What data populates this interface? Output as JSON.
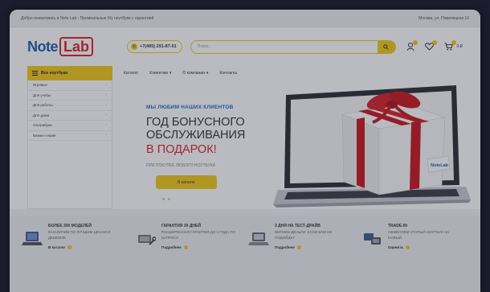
{
  "topbar": {
    "left": "Добро пожаловать в Note Lab - Премиальные б/у ноутбуки с гарантией",
    "right": "Москва, ул. Павелецкая 16"
  },
  "header": {
    "logo_note": "Note",
    "logo_lab": "Lab",
    "phone": "+7(495) 291-87-51",
    "search_placeholder": "Поиск...",
    "cart_count": "0 ₽"
  },
  "nav": {
    "catalog_label": "Все ноутбуки",
    "menu": [
      {
        "label": "Каталог"
      },
      {
        "label": "Клиентам"
      },
      {
        "label": "О компании"
      },
      {
        "label": "Контакты"
      }
    ]
  },
  "sidebar": {
    "items": [
      {
        "label": "Игровые"
      },
      {
        "label": "Для учебы"
      },
      {
        "label": "Для работы"
      },
      {
        "label": "Для дома"
      },
      {
        "label": "Ультрабуки"
      },
      {
        "label": "Бизнес-серия"
      }
    ]
  },
  "hero": {
    "subtitle": "МЫ ЛЮБИМ НАШИХ КЛИЕНТОВ",
    "title_line1": "ГОД БОНУСНОГО",
    "title_line2": "ОБСЛУЖИВАНИЯ",
    "accent": "В ПОДАРОК!",
    "note": "ПРИ ПОКУПКЕ ЛЮБОГО НОУТБУКА",
    "button": "В каталог",
    "gift_tag": "NoteLab"
  },
  "features": [
    {
      "title": "БОЛЕЕ 300 МОДЕЛЕЙ",
      "desc": "В НАЛИЧИИ ПО ЛУЧШИМ ЦЕНАМ И ДЕШЕВЛЕ",
      "link": "В каталог"
    },
    {
      "title": "ГАРАНТИЯ 30 ДНЕЙ",
      "desc": "РАСШИРЕННАЯ ГАРАНТИЯ ДО 1 ГОДА ПО ЗАПРОСУ",
      "link": "Подробнее"
    },
    {
      "title": "3 ДНЯ НА ТЕСТ-ДРАЙВ",
      "desc": "ВЕРНЕМ ДЕНЬГИ, ЕСЛИ ВАМ НЕ ПОДОЙДЕТ",
      "link": "Подробнее"
    },
    {
      "title": "TRADE-IN",
      "desc": "ОБМЕНЯЕМ СТАРЫЙ НОУТБУК НА НОВЫЙ",
      "link": "Оценить"
    }
  ],
  "colors": {
    "accent_yellow": "#f0cb1a",
    "brand_blue": "#1e5fb0",
    "brand_red": "#d8262a",
    "background_dark": "#1b1d2e"
  },
  "icons": [
    "phone-icon",
    "search-icon",
    "user-icon",
    "heart-icon",
    "cart-icon",
    "menu-icon",
    "chevron-right-icon",
    "chevron-down-icon",
    "laptop-icon",
    "wrench-icon",
    "trade-icon"
  ]
}
